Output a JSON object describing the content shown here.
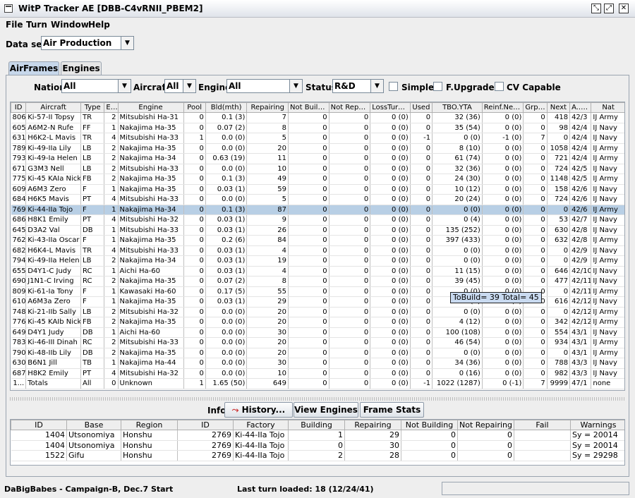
{
  "window": {
    "title": "WitP Tracker AE [DBB-C4vRNII_PBEM2]"
  },
  "menu": [
    {
      "label": "File"
    },
    {
      "label": "Turn"
    },
    {
      "label": "Window"
    },
    {
      "label": "Help"
    }
  ],
  "dataset": {
    "label": "Data set:",
    "value": "Air Production"
  },
  "tabs": [
    {
      "label": "AirFrames"
    },
    {
      "label": "Engines"
    }
  ],
  "filters": {
    "nation_label": "Nation:",
    "nation_value": "All",
    "aircraft_label": "Aircraft:",
    "aircraft_value": "All",
    "engine_label": "Engine:",
    "engine_value": "All",
    "status_label": "Status:",
    "status_value": "R&D",
    "simple_label": "Simple",
    "fupgrades_label": "F.Upgrades",
    "cvcapable_label": "CV Capable"
  },
  "airframes": {
    "columns": [
      "ID",
      "Aircraft",
      "Type",
      "E#",
      "Engine",
      "Pool",
      "Bld(mth)",
      "Repairing",
      "Not Buildi...",
      "Not Repai...",
      "LossTurn...",
      "Used",
      "TBO.YTA",
      "Reinf.Nee...",
      "Grp ...",
      "Next",
      "A... ▲",
      "Nat"
    ],
    "rows": [
      [
        "806",
        "Ki-57-II Topsy",
        "TR",
        "2",
        "Mitsubishi Ha-31",
        "0",
        "0.1 (3)",
        "7",
        "0",
        "0",
        "0 (0)",
        "0",
        "32 (36)",
        "0 (0)",
        "0",
        "418",
        "42/3",
        "IJ Army"
      ],
      [
        "605",
        "A6M2-N Rufe",
        "FF",
        "1",
        "Nakajima Ha-35",
        "0",
        "0.07 (2)",
        "8",
        "0",
        "0",
        "0 (0)",
        "0",
        "35 (54)",
        "0 (0)",
        "0",
        "98",
        "42/4",
        "IJ Navy"
      ],
      [
        "631",
        "H6K2-L Mavis",
        "TR",
        "4",
        "Mitsubishi Ha-33",
        "1",
        "0.0 (0)",
        "5",
        "0",
        "0",
        "0 (0)",
        "-1",
        "0 (0)",
        "-1 (0)",
        "7",
        "0",
        "42/4",
        "IJ Navy"
      ],
      [
        "789",
        "Ki-49-IIa Lily",
        "LB",
        "2",
        "Nakajima Ha-35",
        "0",
        "0.0 (0)",
        "20",
        "0",
        "0",
        "0 (0)",
        "0",
        "8 (10)",
        "0 (0)",
        "0",
        "1058",
        "42/4",
        "IJ Army"
      ],
      [
        "793",
        "Ki-49-Ia Helen",
        "LB",
        "2",
        "Nakajima Ha-34",
        "0",
        "0.63 (19)",
        "11",
        "0",
        "0",
        "0 (0)",
        "0",
        "61 (74)",
        "0 (0)",
        "0",
        "721",
        "42/4",
        "IJ Army"
      ],
      [
        "671",
        "G3M3 Nell",
        "LB",
        "2",
        "Mitsubishi Ha-33",
        "0",
        "0.0 (0)",
        "10",
        "0",
        "0",
        "0 (0)",
        "0",
        "32 (36)",
        "0 (0)",
        "0",
        "724",
        "42/5",
        "IJ Navy"
      ],
      [
        "775",
        "Ki-45 KAIa Nick",
        "FB",
        "2",
        "Nakajima Ha-35",
        "0",
        "0.1 (3)",
        "49",
        "0",
        "0",
        "0 (0)",
        "0",
        "24 (30)",
        "0 (0)",
        "0",
        "1148",
        "42/5",
        "IJ Army"
      ],
      [
        "609",
        "A6M3 Zero",
        "F",
        "1",
        "Nakajima Ha-35",
        "0",
        "0.03 (1)",
        "59",
        "0",
        "0",
        "0 (0)",
        "0",
        "10 (12)",
        "0 (0)",
        "0",
        "158",
        "42/6",
        "IJ Navy"
      ],
      [
        "684",
        "H6K5 Mavis",
        "PT",
        "4",
        "Mitsubishi Ha-33",
        "0",
        "0.0 (0)",
        "5",
        "0",
        "0",
        "0 (0)",
        "0",
        "20 (24)",
        "0 (0)",
        "0",
        "724",
        "42/6",
        "IJ Navy"
      ],
      [
        "769",
        "Ki-44-IIa Tojo",
        "F",
        "1",
        "Nakajima Ha-34",
        "0",
        "0.1 (3)",
        "87",
        "0",
        "0",
        "0 (0)",
        "0",
        "0 (0)",
        "0 (0)",
        "0",
        "0",
        "42/6",
        "IJ Army"
      ],
      [
        "686",
        "H8K1 Emily",
        "PT",
        "4",
        "Mitsubishi Ha-32",
        "0",
        "0.03 (1)",
        "9",
        "0",
        "0",
        "0 (0)",
        "0",
        "0 (4)",
        "0 (0)",
        "0",
        "53",
        "42/7",
        "IJ Navy"
      ],
      [
        "645",
        "D3A2 Val",
        "DB",
        "1",
        "Mitsubishi Ha-33",
        "0",
        "0.03 (1)",
        "26",
        "0",
        "0",
        "0 (0)",
        "0",
        "135 (252)",
        "0 (0)",
        "0",
        "630",
        "42/8",
        "IJ Navy"
      ],
      [
        "762",
        "Ki-43-IIa Oscar",
        "F",
        "1",
        "Nakajima Ha-35",
        "0",
        "0.2 (6)",
        "84",
        "0",
        "0",
        "0 (0)",
        "0",
        "397 (433)",
        "0 (0)",
        "0",
        "632",
        "42/8",
        "IJ Army"
      ],
      [
        "682",
        "H6K4-L Mavis",
        "TR",
        "4",
        "Mitsubishi Ha-33",
        "0",
        "0.03 (1)",
        "4",
        "0",
        "0",
        "0 (0)",
        "0",
        "0 (0)",
        "0 (0)",
        "0",
        "0",
        "42/9",
        "IJ Navy"
      ],
      [
        "794",
        "Ki-49-IIa Helen",
        "LB",
        "2",
        "Nakajima Ha-34",
        "0",
        "0.03 (1)",
        "19",
        "0",
        "0",
        "0 (0)",
        "0",
        "0 (0)",
        "0 (0)",
        "0",
        "0",
        "42/9",
        "IJ Army"
      ],
      [
        "655",
        "D4Y1-C Judy",
        "RC",
        "1",
        "Aichi Ha-60",
        "0",
        "0.03 (1)",
        "4",
        "0",
        "0",
        "0 (0)",
        "0",
        "11 (15)",
        "0 (0)",
        "0",
        "646",
        "42/10",
        "IJ Navy"
      ],
      [
        "690",
        "J1N1-C Irving",
        "RC",
        "2",
        "Nakajima Ha-35",
        "0",
        "0.07 (2)",
        "8",
        "0",
        "0",
        "0 (0)",
        "0",
        "39 (45)",
        "0 (0)",
        "0",
        "477",
        "42/11",
        "IJ Navy"
      ],
      [
        "809",
        "Ki-61-Ia Tony",
        "F",
        "1",
        "Kawasaki Ha-60",
        "0",
        "0.17 (5)",
        "55",
        "0",
        "0",
        "0 (0)",
        "0",
        "0 (0)",
        "0 (0)",
        "0",
        "0",
        "42/11",
        "IJ Army"
      ],
      [
        "610",
        "A6M3a Zero",
        "F",
        "1",
        "Nakajima Ha-35",
        "0",
        "0.03 (1)",
        "29",
        "0",
        "0",
        "0 (0)",
        "0",
        "0 (0)",
        "0 (0)",
        "0",
        "616",
        "42/12",
        "IJ Navy"
      ],
      [
        "748",
        "Ki-21-IIb Sally",
        "LB",
        "2",
        "Mitsubishi Ha-32",
        "0",
        "0.0 (0)",
        "20",
        "0",
        "0",
        "0 (0)",
        "0",
        "0 (0)",
        "0 (0)",
        "0",
        "0",
        "42/12",
        "IJ Army"
      ],
      [
        "776",
        "Ki-45 KAIb Nick",
        "FB",
        "2",
        "Nakajima Ha-35",
        "0",
        "0.0 (0)",
        "20",
        "0",
        "0",
        "0 (0)",
        "0",
        "4 (12)",
        "0 (0)",
        "0",
        "342",
        "42/12",
        "IJ Army"
      ],
      [
        "649",
        "D4Y1 Judy",
        "DB",
        "1",
        "Aichi Ha-60",
        "0",
        "0.0 (0)",
        "30",
        "0",
        "0",
        "0 (0)",
        "0",
        "100 (108)",
        "0 (0)",
        "0",
        "554",
        "43/1",
        "IJ Navy"
      ],
      [
        "783",
        "Ki-46-III Dinah",
        "RC",
        "2",
        "Mitsubishi Ha-33",
        "0",
        "0.0 (0)",
        "20",
        "0",
        "0",
        "0 (0)",
        "0",
        "46 (54)",
        "0 (0)",
        "0",
        "934",
        "43/1",
        "IJ Army"
      ],
      [
        "790",
        "Ki-48-IIb Lily",
        "DB",
        "2",
        "Nakajima Ha-35",
        "0",
        "0.0 (0)",
        "20",
        "0",
        "0",
        "0 (0)",
        "0",
        "0 (0)",
        "0 (0)",
        "0",
        "0",
        "43/1",
        "IJ Army"
      ],
      [
        "630",
        "B6N1 Jill",
        "TB",
        "1",
        "Nakajima Ha-44",
        "0",
        "0.0 (0)",
        "30",
        "0",
        "0",
        "0 (0)",
        "0",
        "34 (36)",
        "0 (0)",
        "0",
        "788",
        "43/3",
        "IJ Navy"
      ],
      [
        "687",
        "H8K2 Emily",
        "PT",
        "4",
        "Mitsubishi Ha-32",
        "0",
        "0.0 (0)",
        "10",
        "0",
        "0",
        "0 (0)",
        "0",
        "0 (16)",
        "0 (0)",
        "0",
        "982",
        "43/3",
        "IJ Navy"
      ],
      [
        "1...",
        "Totals",
        "All",
        "0",
        "Unknown",
        "1",
        "1.65 (50)",
        "649",
        "0",
        "0",
        "0 (0)",
        "-1",
        "1022 (1287)",
        "0 (-1)",
        "7",
        "9999",
        "47/1",
        "none"
      ]
    ],
    "selected_row": 9
  },
  "tooltip": {
    "text": "ToBuild= 39 Total= 45"
  },
  "info": {
    "label": "Info:",
    "history_button": "History...",
    "view_engines_button": "View Engines",
    "frame_stats_button": "Frame Stats"
  },
  "factories": {
    "columns": [
      "ID",
      "Base",
      "Region",
      "ID",
      "Factory",
      "Building",
      "Repairing",
      "Not Building",
      "Not Repairing",
      "Fail",
      "Warnings"
    ],
    "rows": [
      [
        "1404",
        "Utsonomiya",
        "Honshu",
        "2769",
        "Ki-44-IIa Tojo",
        "1",
        "29",
        "0",
        "0",
        "",
        "Sy = 20014"
      ],
      [
        "1404",
        "Utsonomiya",
        "Honshu",
        "2769",
        "Ki-44-IIa Tojo",
        "0",
        "30",
        "0",
        "0",
        "",
        "Sy = 20014"
      ],
      [
        "1522",
        "Gifu",
        "Honshu",
        "2769",
        "Ki-44-IIa Tojo",
        "2",
        "28",
        "0",
        "0",
        "",
        "Sy = 29298"
      ]
    ]
  },
  "status": {
    "campaign": "DaBigBabes - Campaign-B, Dec.7 Start",
    "last_turn": "Last turn loaded: 18 (12/24/41)"
  }
}
